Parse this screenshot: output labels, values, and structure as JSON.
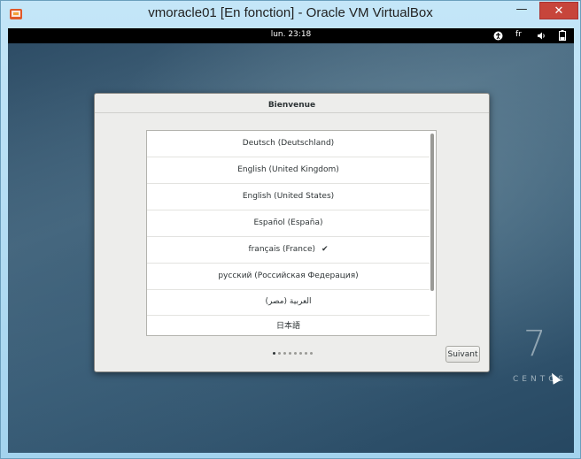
{
  "window": {
    "title": "vmoracle01 [En fonction] - Oracle VM VirtualBox",
    "minimize_label": "—",
    "close_label": "✕",
    "app_icon": "virtualbox-icon"
  },
  "topbar": {
    "clock": "lun. 23:18",
    "keyboard_layout": "fr",
    "accessibility_icon": "accessibility-icon",
    "volume_icon": "volume-icon",
    "battery_icon": "battery-icon"
  },
  "dialog": {
    "title": "Bienvenue",
    "languages": [
      "Deutsch (Deutschland)",
      "English (United Kingdom)",
      "English (United States)",
      "Español (España)",
      "français (France)",
      "русский (Российская Федерация)",
      "العربية (مصر)",
      "日本語"
    ],
    "selected_language": "français (France)",
    "check_mark": "✔",
    "page_count": 8,
    "current_page": 1,
    "next_button": "Suivant"
  },
  "watermark": {
    "version": "7",
    "brand": "CENTOS"
  }
}
